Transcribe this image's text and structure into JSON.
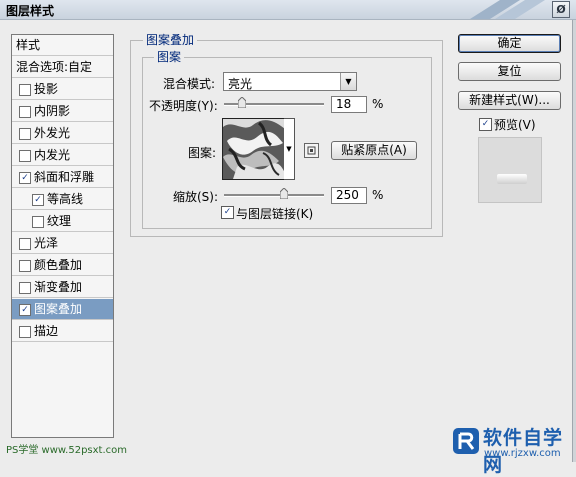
{
  "window": {
    "title": "图层样式",
    "close_symbol": "Ø"
  },
  "left_panel": {
    "header": "样式",
    "blend_options": "混合选项:自定",
    "items": [
      {
        "label": "投影",
        "checked": false
      },
      {
        "label": "内阴影",
        "checked": false
      },
      {
        "label": "外发光",
        "checked": false
      },
      {
        "label": "内发光",
        "checked": false
      },
      {
        "label": "斜面和浮雕",
        "checked": true
      },
      {
        "label": "等高线",
        "checked": true
      },
      {
        "label": "纹理",
        "checked": false
      },
      {
        "label": "光泽",
        "checked": false
      },
      {
        "label": "颜色叠加",
        "checked": false
      },
      {
        "label": "渐变叠加",
        "checked": false
      },
      {
        "label": "图案叠加",
        "checked": true
      },
      {
        "label": "描边",
        "checked": false
      }
    ]
  },
  "panel": {
    "group_title": "图案叠加",
    "subgroup_title": "图案",
    "blend_mode_label": "混合模式:",
    "blend_mode_value": "亮光",
    "opacity_label": "不透明度(Y):",
    "opacity_value": "18",
    "opacity_unit": "%",
    "opacity_level": 0.18,
    "pattern_label": "图案:",
    "snap_origin_button": "贴紧原点(A)",
    "scale_label": "缩放(S):",
    "scale_value": "250",
    "scale_unit": "%",
    "scale_level": 0.6,
    "link_label": "与图层链接(K)",
    "link_checked": true
  },
  "buttons": {
    "ok": "确定",
    "reset": "复位",
    "new_style": "新建样式(W)...",
    "preview_label": "预览(V)",
    "preview_checked": true
  },
  "watermark": {
    "left": "PS学堂 www.52psxt.com",
    "right_name": "软件自学网",
    "right_url": "www.rjzxw.com"
  },
  "colors": {
    "selected_row": "#7a9cc2",
    "group_title": "#00287a",
    "watermark_blue": "#1e5fae"
  }
}
